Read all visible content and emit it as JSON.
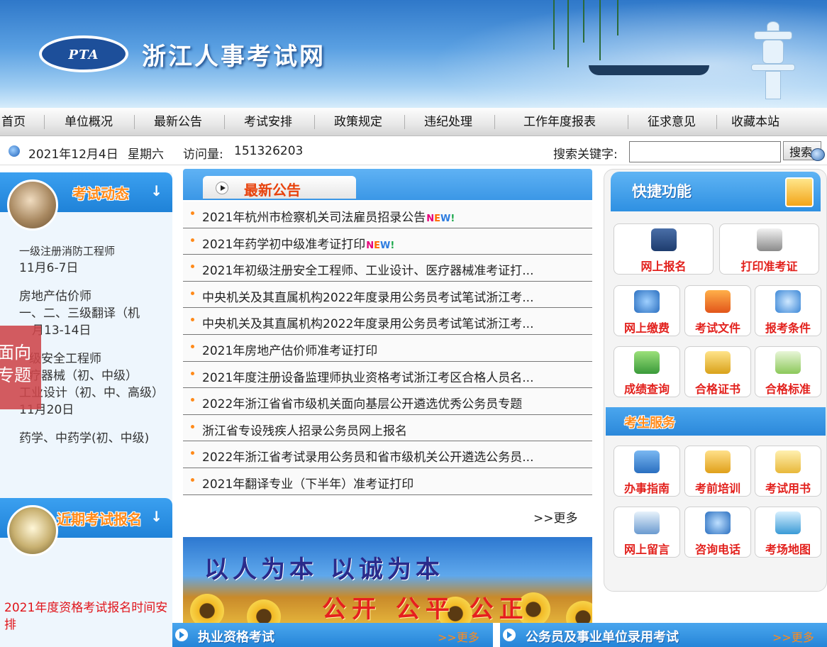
{
  "site": {
    "title": "浙江人事考试网",
    "logo_text": "PTA"
  },
  "nav": [
    "首页",
    "单位概况",
    "最新公告",
    "考试安排",
    "政策规定",
    "违纪处理",
    "工作年度报表",
    "征求意见",
    "收藏本站"
  ],
  "info": {
    "date": "2021年12月4日",
    "weekday": "星期六",
    "visits_label": "访问量:",
    "visits": "151326203",
    "search_label": "搜索关键字:",
    "search_value": "",
    "search_button": "搜索"
  },
  "left": {
    "exam_news_title": "考试动态",
    "exam_items": [
      {
        "name": "一级注册消防工程师",
        "date": "11月6-7日"
      },
      {
        "name": "房地产估价师",
        "detail": "一、二、三级翻译（机",
        "date": "月13-14日"
      },
      {
        "name": "级安全工程师",
        "detail": "疗器械（初、中级）",
        "detail2": "工业设计（初、中、高级）",
        "date": "11月20日"
      },
      {
        "name": "药学、中药学(初、中级)"
      }
    ],
    "float_ad": [
      "面向",
      "专题"
    ],
    "recent_title": "近期考试报名",
    "recent_link": "2021年度资格考试报名时间安排"
  },
  "middle": {
    "tab_title": "最新公告",
    "news": [
      {
        "text": "2021年杭州市检察机关司法雇员招录公告",
        "new": true
      },
      {
        "text": "2021年药学初中级准考证打印",
        "new": true
      },
      {
        "text": "2021年初级注册安全工程师、工业设计、医疗器械准考证打...",
        "new": false
      },
      {
        "text": "中央机关及其直属机构2022年度录用公务员考试笔试浙江考...",
        "new": false
      },
      {
        "text": "中央机关及其直属机构2022年度录用公务员考试笔试浙江考...",
        "new": false
      },
      {
        "text": "2021年房地产估价师准考证打印",
        "new": false
      },
      {
        "text": "2021年度注册设备监理师执业资格考试浙江考区合格人员名...",
        "new": false
      },
      {
        "text": "2022年浙江省省市级机关面向基层公开遴选优秀公务员专题",
        "new": false
      },
      {
        "text": "浙江省专设残疾人招录公务员网上报名",
        "new": false
      },
      {
        "text": "2022年浙江省考试录用公务员和省市级机关公开遴选公务员...",
        "new": false
      },
      {
        "text": "2021年翻译专业（下半年）准考证打印",
        "new": false
      }
    ],
    "new_badge": "NEW!",
    "more": ">>更多",
    "slogan_line1": "以人为本 以诚为本",
    "slogan_line2": "公开 公平 公正"
  },
  "right": {
    "quick_title": "快捷功能",
    "quick_top": [
      "网上报名",
      "打印准考证"
    ],
    "quick_grid": [
      "网上缴费",
      "考试文件",
      "报考条件",
      "成绩查询",
      "合格证书",
      "合格标准"
    ],
    "service_title": "考生服务",
    "service_grid": [
      "办事指南",
      "考前培训",
      "考试用书",
      "网上留言",
      "咨询电话",
      "考场地图"
    ]
  },
  "bottom": {
    "left_title": "执业资格考试",
    "left_more": ">>更多",
    "right_title": "公务员及事业单位录用考试",
    "right_more": ">>更多"
  },
  "colors": {
    "accent_blue": "#2e90e2",
    "accent_orange": "#ff8a1a",
    "link_red": "#e0141a",
    "new_badge": [
      "#e6007a",
      "#ff6a00",
      "#2e7de0",
      "#1aa84a"
    ]
  }
}
